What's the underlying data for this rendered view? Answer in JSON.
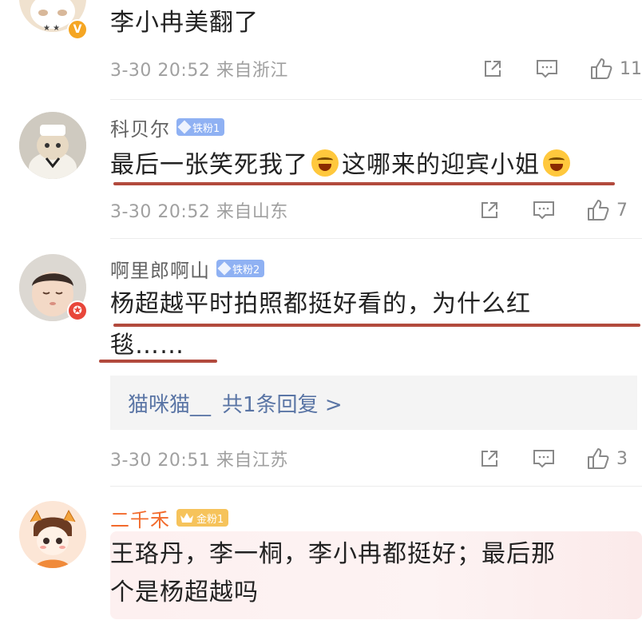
{
  "comments": [
    {
      "username": "",
      "text": "李小冉美翻了",
      "meta": "3-30 20:52 来自浙江",
      "likes": "11"
    },
    {
      "username": "科贝尔",
      "badge": "铁粉1",
      "text_part1": "最后一张笑死我了",
      "text_part2": "这哪来的迎宾小姐",
      "meta": "3-30 20:52 来自山东",
      "likes": "7"
    },
    {
      "username": "啊里郎啊山",
      "badge": "铁粉2",
      "text_line1": "杨超越平时拍照都挺好看的，为什么红",
      "text_line2": "毯……",
      "reply_user": "猫咪猫__",
      "reply_summary": "共1条回复 >",
      "meta": "3-30 20:51 来自江苏",
      "likes": "3"
    },
    {
      "username": "二千禾",
      "badge": "金粉1",
      "text_line1": "王珞丹，李一桐，李小冉都挺好；最后那",
      "text_line2": "个是杨超越吗"
    }
  ],
  "colors": {
    "underline": "#b24a3d",
    "iron_badge": "#8fb1f3",
    "gold_badge": "#f6c35b",
    "link": "#5a75a5",
    "gold_name": "#f26a2b"
  },
  "icons": [
    "share-icon",
    "comment-icon",
    "thumbs-up-icon",
    "laughing-emoji-icon",
    "vip-v-icon",
    "star-badge-icon"
  ]
}
